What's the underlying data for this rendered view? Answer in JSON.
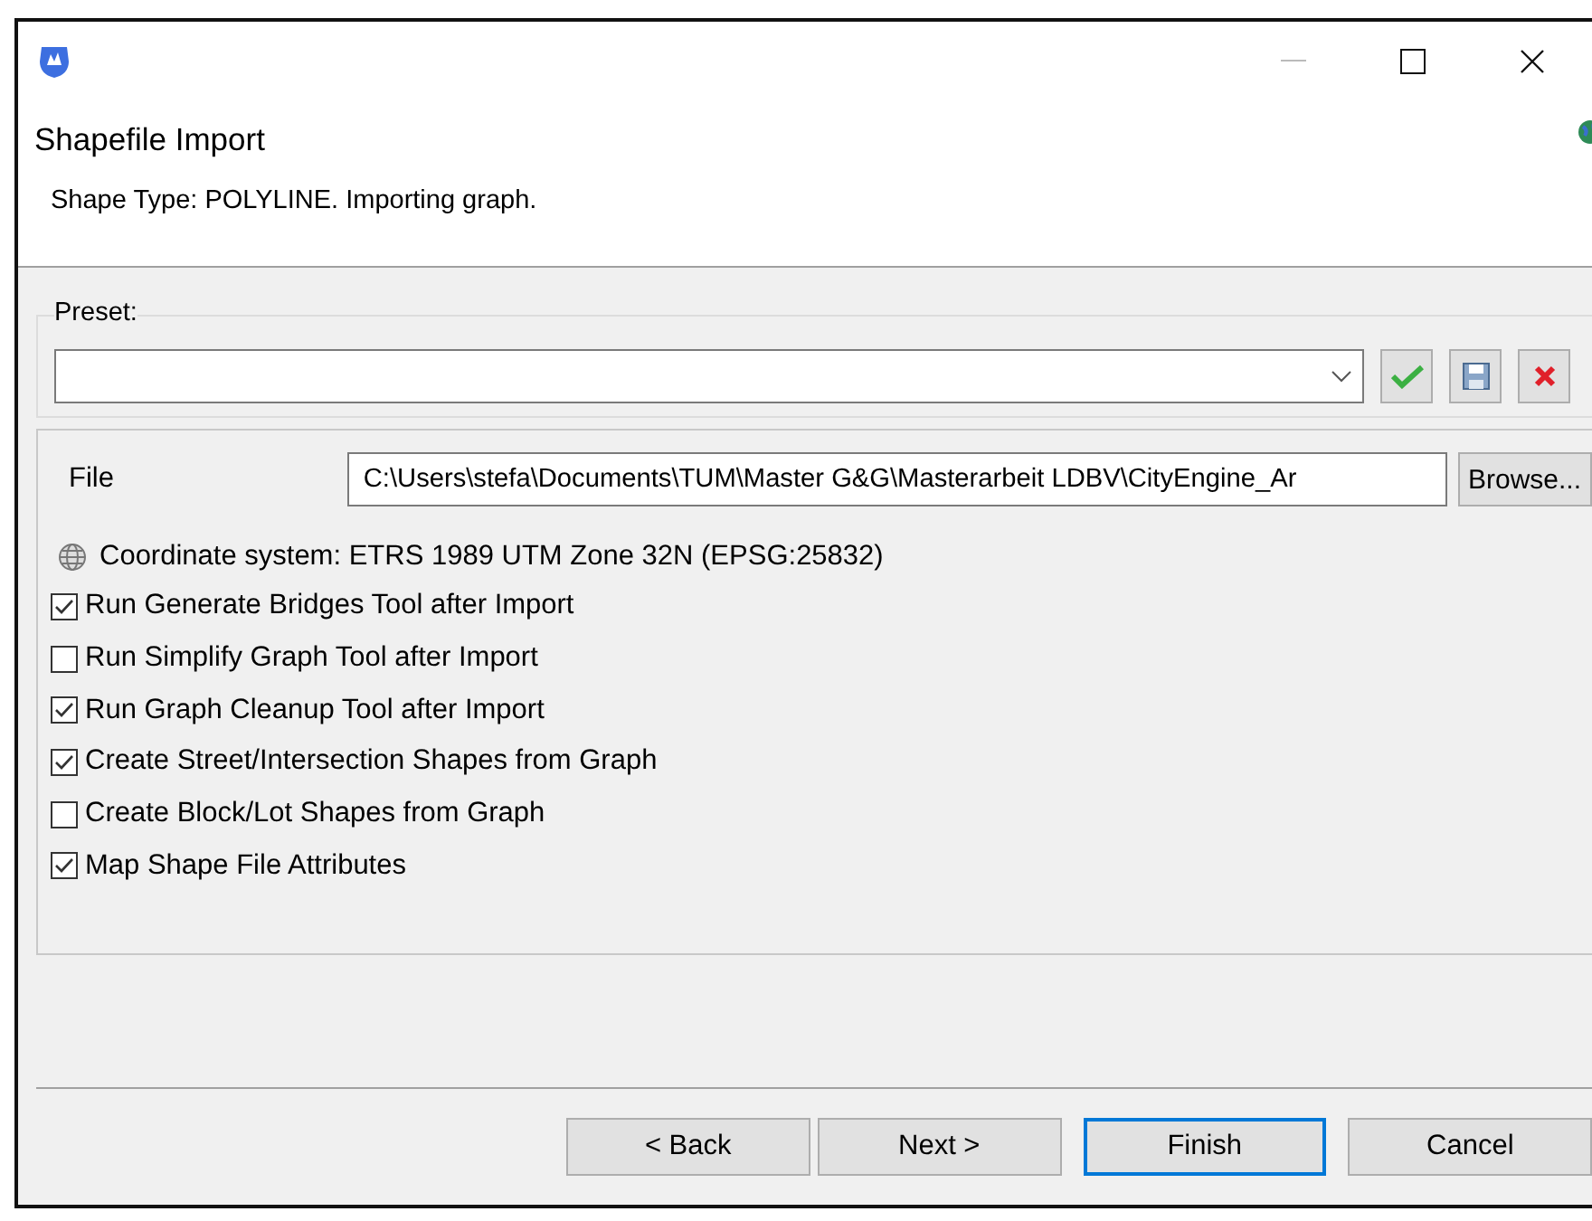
{
  "window": {
    "title": "Shapefile Import",
    "description": "Shape Type: POLYLINE. Importing graph."
  },
  "preset": {
    "label": "Preset:"
  },
  "file": {
    "label": "File",
    "value": "C:\\Users\\stefa\\Documents\\TUM\\Master G&G\\Masterarbeit LDBV\\CityEngine_Ar",
    "browse": "Browse..."
  },
  "coordinate_system": "Coordinate system: ETRS 1989 UTM Zone 32N (EPSG:25832)",
  "options": [
    {
      "label": "Run Generate Bridges Tool after Import",
      "checked": true
    },
    {
      "label": "Run Simplify Graph Tool after Import",
      "checked": false
    },
    {
      "label": "Run Graph Cleanup Tool after Import",
      "checked": true
    },
    {
      "label": "Create Street/Intersection Shapes from Graph",
      "checked": true
    },
    {
      "label": "Create Block/Lot Shapes from Graph",
      "checked": false
    },
    {
      "label": "Map Shape File Attributes",
      "checked": true
    }
  ],
  "buttons": [
    {
      "label": "< Back",
      "default": false
    },
    {
      "label": "Next >",
      "default": false
    },
    {
      "label": "Finish",
      "default": true
    },
    {
      "label": "Cancel",
      "default": false
    }
  ]
}
